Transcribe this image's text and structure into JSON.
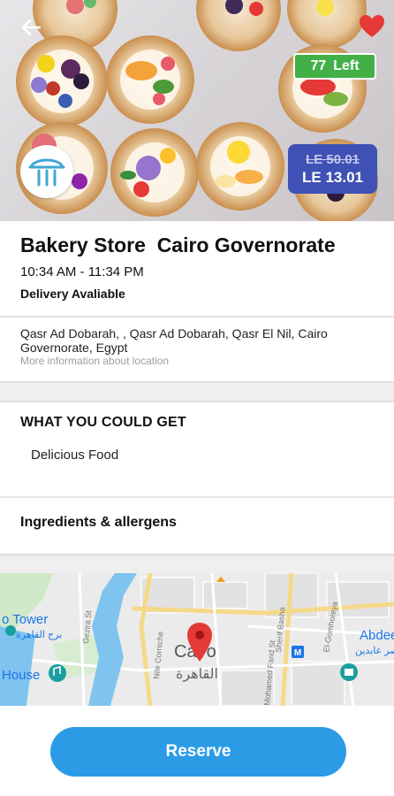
{
  "hero": {
    "items_left_count": "77",
    "items_left_label": "Left",
    "original_price": "LE 50.01",
    "price": "LE 13.01",
    "back_icon": "arrow-left-icon",
    "favorite_icon": "heart-icon",
    "favorite_color": "#e53935",
    "badge_color": "#43b047",
    "price_badge_color": "#3f51b5"
  },
  "store": {
    "name": "Bakery Store  Cairo Governorate",
    "hours": "10:34 AM - 11:34 PM",
    "delivery": "Delivery Avaliable"
  },
  "address": {
    "text": "Qasr Ad Dobarah, , Qasr Ad Dobarah, Qasr El Nil, Cairo Governorate, Egypt",
    "more": "More information about location"
  },
  "what_you_get": {
    "title": "WHAT YOU COULD GET",
    "item": "Delicious Food"
  },
  "ingredients": {
    "label": "Ingredients & allergens"
  },
  "map": {
    "tower": "o Tower",
    "tower_ar": "برج القاهرة",
    "house": "House",
    "city": "Cairo",
    "city_ar": "القاهرة",
    "abdeen": "Abdeen P",
    "abdeen_ar": "قصر عابدين",
    "streets": [
      "Gezira St",
      "Nile Corniche",
      "Sherif Basha",
      "El-Gomhoreya",
      "Mohamed Farid St"
    ],
    "pin_color": "#e53935"
  },
  "action": {
    "reserve_label": "Reserve",
    "button_color": "#2c9be6"
  }
}
